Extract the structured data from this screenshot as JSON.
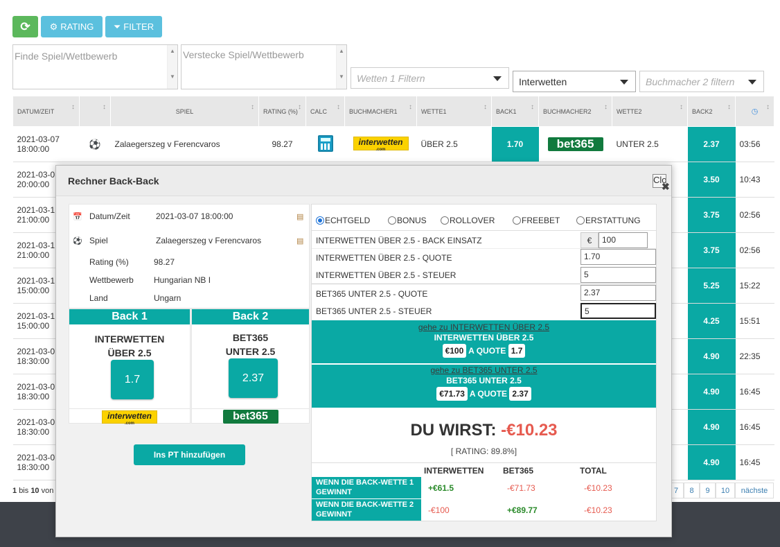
{
  "toolbar": {
    "refresh_icon": "refresh-icon",
    "rating_label": "RATING",
    "filter_label": "FILTER"
  },
  "filters": {
    "find_placeholder": "Finde Spiel/Wettbewerb",
    "hide_placeholder": "Verstecke Spiel/Wettbewerb",
    "wetten1_placeholder": "Wetten 1 Filtern",
    "bookmaker1_value": "Interwetten",
    "bookmaker2_placeholder": "Buchmacher 2 filtern"
  },
  "table": {
    "headers": [
      "DATUM/ZEIT",
      "",
      "SPIEL",
      "RATING (%)",
      "CALC",
      "BUCHMACHER1",
      "WETTE1",
      "BACK1",
      "BUCHMACHER2",
      "WETTE2",
      "BACK2",
      ""
    ],
    "first_row": {
      "date": "2021-03-07",
      "time": "18:00:00",
      "game": "Zalaegerszeg v Ferencvaros",
      "rating": "98.27",
      "bookmaker1": "interwetten",
      "bet1": "ÜBER 2.5",
      "back1": "1.70",
      "bookmaker2": "bet365",
      "bet2": "UNTER 2.5",
      "back2": "2.37",
      "timer": "03:56"
    },
    "rows": [
      {
        "date": "2021-03-0",
        "time": "20:00:00",
        "back2": "3.50",
        "timer": "10:43"
      },
      {
        "date": "2021-03-1",
        "time": "21:00:00",
        "back2": "3.75",
        "timer": "02:56"
      },
      {
        "date": "2021-03-1",
        "time": "21:00:00",
        "back2": "3.75",
        "timer": "02:56"
      },
      {
        "date": "2021-03-1",
        "time": "15:00:00",
        "back2": "5.25",
        "timer": "15:22"
      },
      {
        "date": "2021-03-1",
        "time": "15:00:00",
        "back2": "4.25",
        "timer": "15:51"
      },
      {
        "date": "2021-03-0",
        "time": "18:30:00",
        "back2": "4.90",
        "timer": "22:35"
      },
      {
        "date": "2021-03-0",
        "time": "18:30:00",
        "back2": "4.90",
        "timer": "16:45"
      },
      {
        "date": "2021-03-0",
        "time": "18:30:00",
        "back2": "4.90",
        "timer": "16:45"
      },
      {
        "date": "2021-03-0",
        "time": "18:30:00",
        "back2": "4.90",
        "timer": "16:45"
      }
    ]
  },
  "footer": {
    "info_from": "1",
    "info_mid": "bis",
    "info_to": "10",
    "info_von": "von"
  },
  "pagination": {
    "pages": [
      "7",
      "8",
      "9",
      "10"
    ],
    "next": "nächste"
  },
  "modal": {
    "title": "Rechner Back-Back",
    "close": "Clos",
    "info": {
      "datum_label": "Datum/Zeit",
      "datum_value": "2021-03-07 18:00:00",
      "spiel_label": "Spiel",
      "spiel_value": "Zalaegerszeg v Ferencvaros",
      "rating_label": "Rating (%)",
      "rating_value": "98.27",
      "wettbewerb_label": "Wettbewerb",
      "wettbewerb_value": "Hungarian NB I",
      "land_label": "Land",
      "land_value": "Ungarn"
    },
    "back1": {
      "header": "Back 1",
      "bookmaker": "INTERWETTEN",
      "bet": "ÜBER 2.5",
      "odds": "1.7",
      "logo": "interwetten",
      "logo_sub": ".com"
    },
    "back2": {
      "header": "Back 2",
      "bookmaker": "BET365",
      "bet": "UNTER 2.5",
      "odds": "2.37",
      "logo": "bet365"
    },
    "add_button": "Ins PT hinzufügen",
    "modes": [
      "ECHTGELD",
      "BONUS",
      "ROLLOVER",
      "FREEBET",
      "ERSTATTUNG"
    ],
    "form": {
      "stake_label": "INTERWETTEN ÜBER 2.5 - BACK EINSATZ",
      "currency": "€",
      "stake_value": "100",
      "quote1_label": "INTERWETTEN ÜBER 2.5 - QUOTE",
      "quote1_value": "1.70",
      "tax1_label": "INTERWETTEN ÜBER 2.5 - STEUER",
      "tax1_value": "5",
      "quote2_label": "BET365 UNTER 2.5  - QUOTE",
      "quote2_value": "2.37",
      "tax2_label": "BET365 UNTER 2.5 - STEUER",
      "tax2_value": "5"
    },
    "go1": {
      "link": "gehe zu INTERWETTEN ÜBER 2.5",
      "title": "INTERWETTEN ÜBER 2.5",
      "stake": "€100",
      "a_quote": "A QUOTE",
      "odds": "1.7"
    },
    "go2": {
      "link": "gehe zu BET365 UNTER 2.5",
      "title": "BET365 UNTER 2.5",
      "stake": "€71.73",
      "a_quote": "A QUOTE",
      "odds": "2.37"
    },
    "result": {
      "label": "DU WIRST:",
      "value": "-€10.23",
      "rating": "[ RATING: 89.8%]"
    },
    "summary": {
      "headers": [
        "INTERWETTEN",
        "BET365",
        "TOTAL"
      ],
      "row1": {
        "label": "WENN DIE BACK-WETTE 1 GEWINNT",
        "v1": "+€61.5",
        "v2": "-€71.73",
        "total": "-€10.23"
      },
      "row2": {
        "label": "WENN DIE BACK-WETTE 2 GEWINNT",
        "v1": "-€100",
        "v2": "+€89.77",
        "total": "-€10.23"
      }
    }
  },
  "colors": {
    "teal": "#0aa9a4",
    "green_button": "#5cb85c",
    "blue_button": "#5bc0de",
    "loss_red": "#e65a4f",
    "gain_green": "#2a8a2a"
  }
}
